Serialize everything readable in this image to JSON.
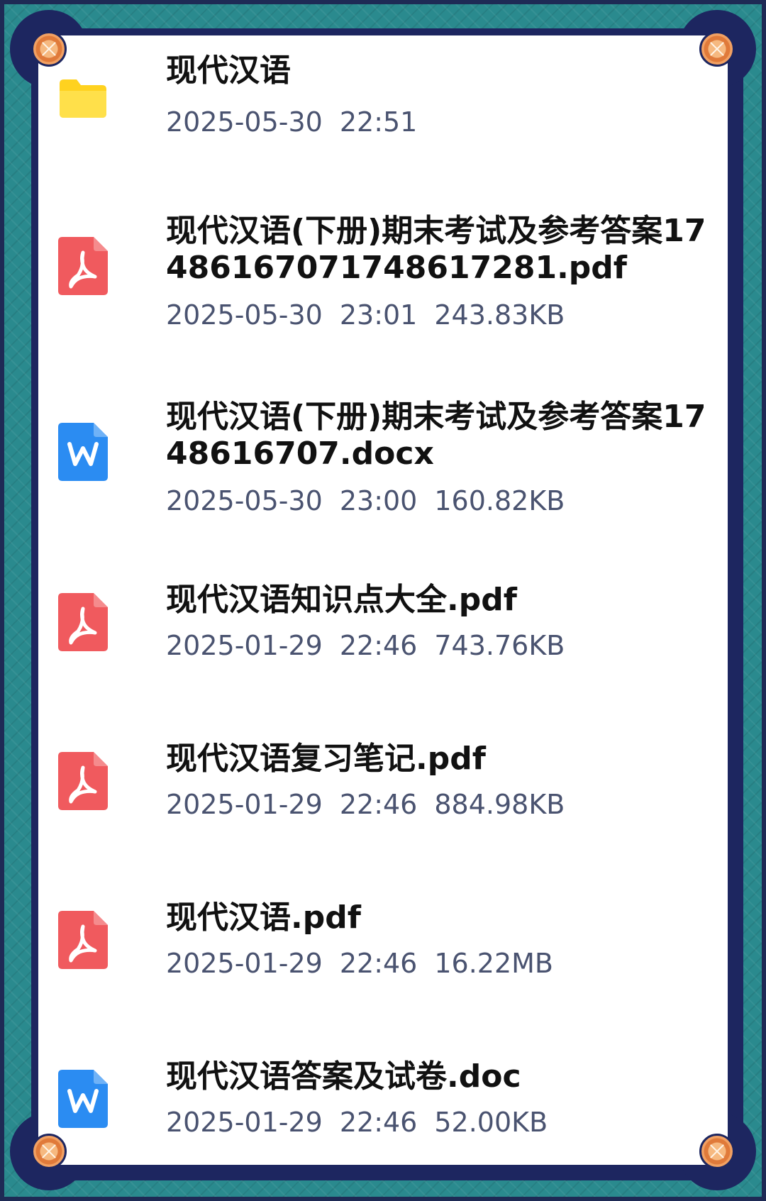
{
  "colors": {
    "frame_teal": "#2a8a8e",
    "frame_navy": "#1d2660",
    "pdf_red": "#f05a5e",
    "word_blue": "#2b8cf2",
    "folder_yellow": "#ffd21f",
    "meta_gray": "#4a5370"
  },
  "files": [
    {
      "icon": "folder-icon",
      "name": "现代汉语",
      "date": "2025-05-30",
      "time": "22:51",
      "size": ""
    },
    {
      "icon": "pdf-icon",
      "name": "现代汉语(下册)期末考试及参考答案17486167071748617281.pdf",
      "date": "2025-05-30",
      "time": "23:01",
      "size": "243.83KB"
    },
    {
      "icon": "word-icon",
      "name": "现代汉语(下册)期末考试及参考答案1748616707.docx",
      "date": "2025-05-30",
      "time": "23:00",
      "size": "160.82KB"
    },
    {
      "icon": "pdf-icon",
      "name": "现代汉语知识点大全.pdf",
      "date": "2025-01-29",
      "time": "22:46",
      "size": "743.76KB"
    },
    {
      "icon": "pdf-icon",
      "name": "现代汉语复习笔记.pdf",
      "date": "2025-01-29",
      "time": "22:46",
      "size": "884.98KB"
    },
    {
      "icon": "pdf-icon",
      "name": "现代汉语.pdf",
      "date": "2025-01-29",
      "time": "22:46",
      "size": "16.22MB"
    },
    {
      "icon": "word-icon",
      "name": "现代汉语答案及试卷.doc",
      "date": "2025-01-29",
      "time": "22:46",
      "size": "52.00KB"
    }
  ]
}
